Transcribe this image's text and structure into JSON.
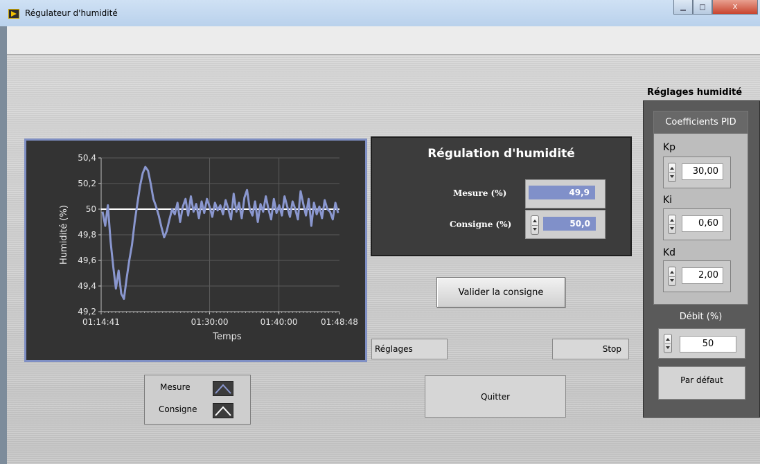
{
  "window": {
    "title": "Régulateur d'humidité",
    "min_glyph": "▁",
    "max_glyph": "□",
    "close_glyph": "X"
  },
  "chart_data": {
    "type": "line",
    "xlabel": "Temps",
    "ylabel": "Humidité (%)",
    "ylim": [
      49.2,
      50.4
    ],
    "yticks": [
      "50,4",
      "50,2",
      "50",
      "49,8",
      "49,6",
      "49,4",
      "49,2"
    ],
    "xticks": [
      "01:14:41",
      "01:30:00",
      "01:40:00",
      "01:48:48"
    ],
    "grid": true,
    "series": [
      {
        "name": "Mesure",
        "color": "#8a97cf",
        "values": [
          49.98,
          49.87,
          50.03,
          49.75,
          49.55,
          49.38,
          49.52,
          49.34,
          49.3,
          49.46,
          49.6,
          49.72,
          49.9,
          50.04,
          50.18,
          50.28,
          50.33,
          50.3,
          50.2,
          50.08,
          50.02,
          49.95,
          49.86,
          49.78,
          49.83,
          49.92,
          50.0,
          49.96,
          50.05,
          49.9,
          50.02,
          50.08,
          49.95,
          50.1,
          49.98,
          50.04,
          49.93,
          50.06,
          49.97,
          50.08,
          50.02,
          49.94,
          50.05,
          49.99,
          50.03,
          49.96,
          50.07,
          50.0,
          49.92,
          50.12,
          49.98,
          50.05,
          49.93,
          50.09,
          50.15,
          50.0,
          49.95,
          50.06,
          49.9,
          50.04,
          49.98,
          50.1,
          50.0,
          49.92,
          50.08,
          49.97,
          50.03,
          49.95,
          50.1,
          50.02,
          49.94,
          50.06,
          50.0,
          49.92,
          50.14,
          50.04,
          49.95,
          50.08,
          49.87,
          50.05,
          49.96,
          50.02,
          49.93,
          50.07,
          50.0,
          49.98,
          49.92,
          50.05,
          49.97
        ]
      },
      {
        "name": "Consigne",
        "color": "#ffffff",
        "values": [
          50.0,
          50.0
        ]
      }
    ]
  },
  "regulation": {
    "title": "Régulation d'humidité",
    "mesure_label": "Mesure  (%)",
    "mesure_value": "49,9",
    "consigne_label": "Consigne (%)",
    "consigne_value": "50,0"
  },
  "buttons": {
    "valider": "Valider la consigne",
    "reglages": "Réglages",
    "stop": "Stop",
    "quitter": "Quitter",
    "par_defaut": "Par défaut"
  },
  "legend": {
    "mesure": "Mesure",
    "consigne": "Consigne"
  },
  "settings": {
    "title": "Réglages humidité",
    "pid_title": "Coefficients PID",
    "kp_label": "Kp",
    "kp_value": "30,00",
    "ki_label": "Ki",
    "ki_value": "0,60",
    "kd_label": "Kd",
    "kd_value": "2,00",
    "debit_label": "Débit (%)",
    "debit_value": "50"
  }
}
